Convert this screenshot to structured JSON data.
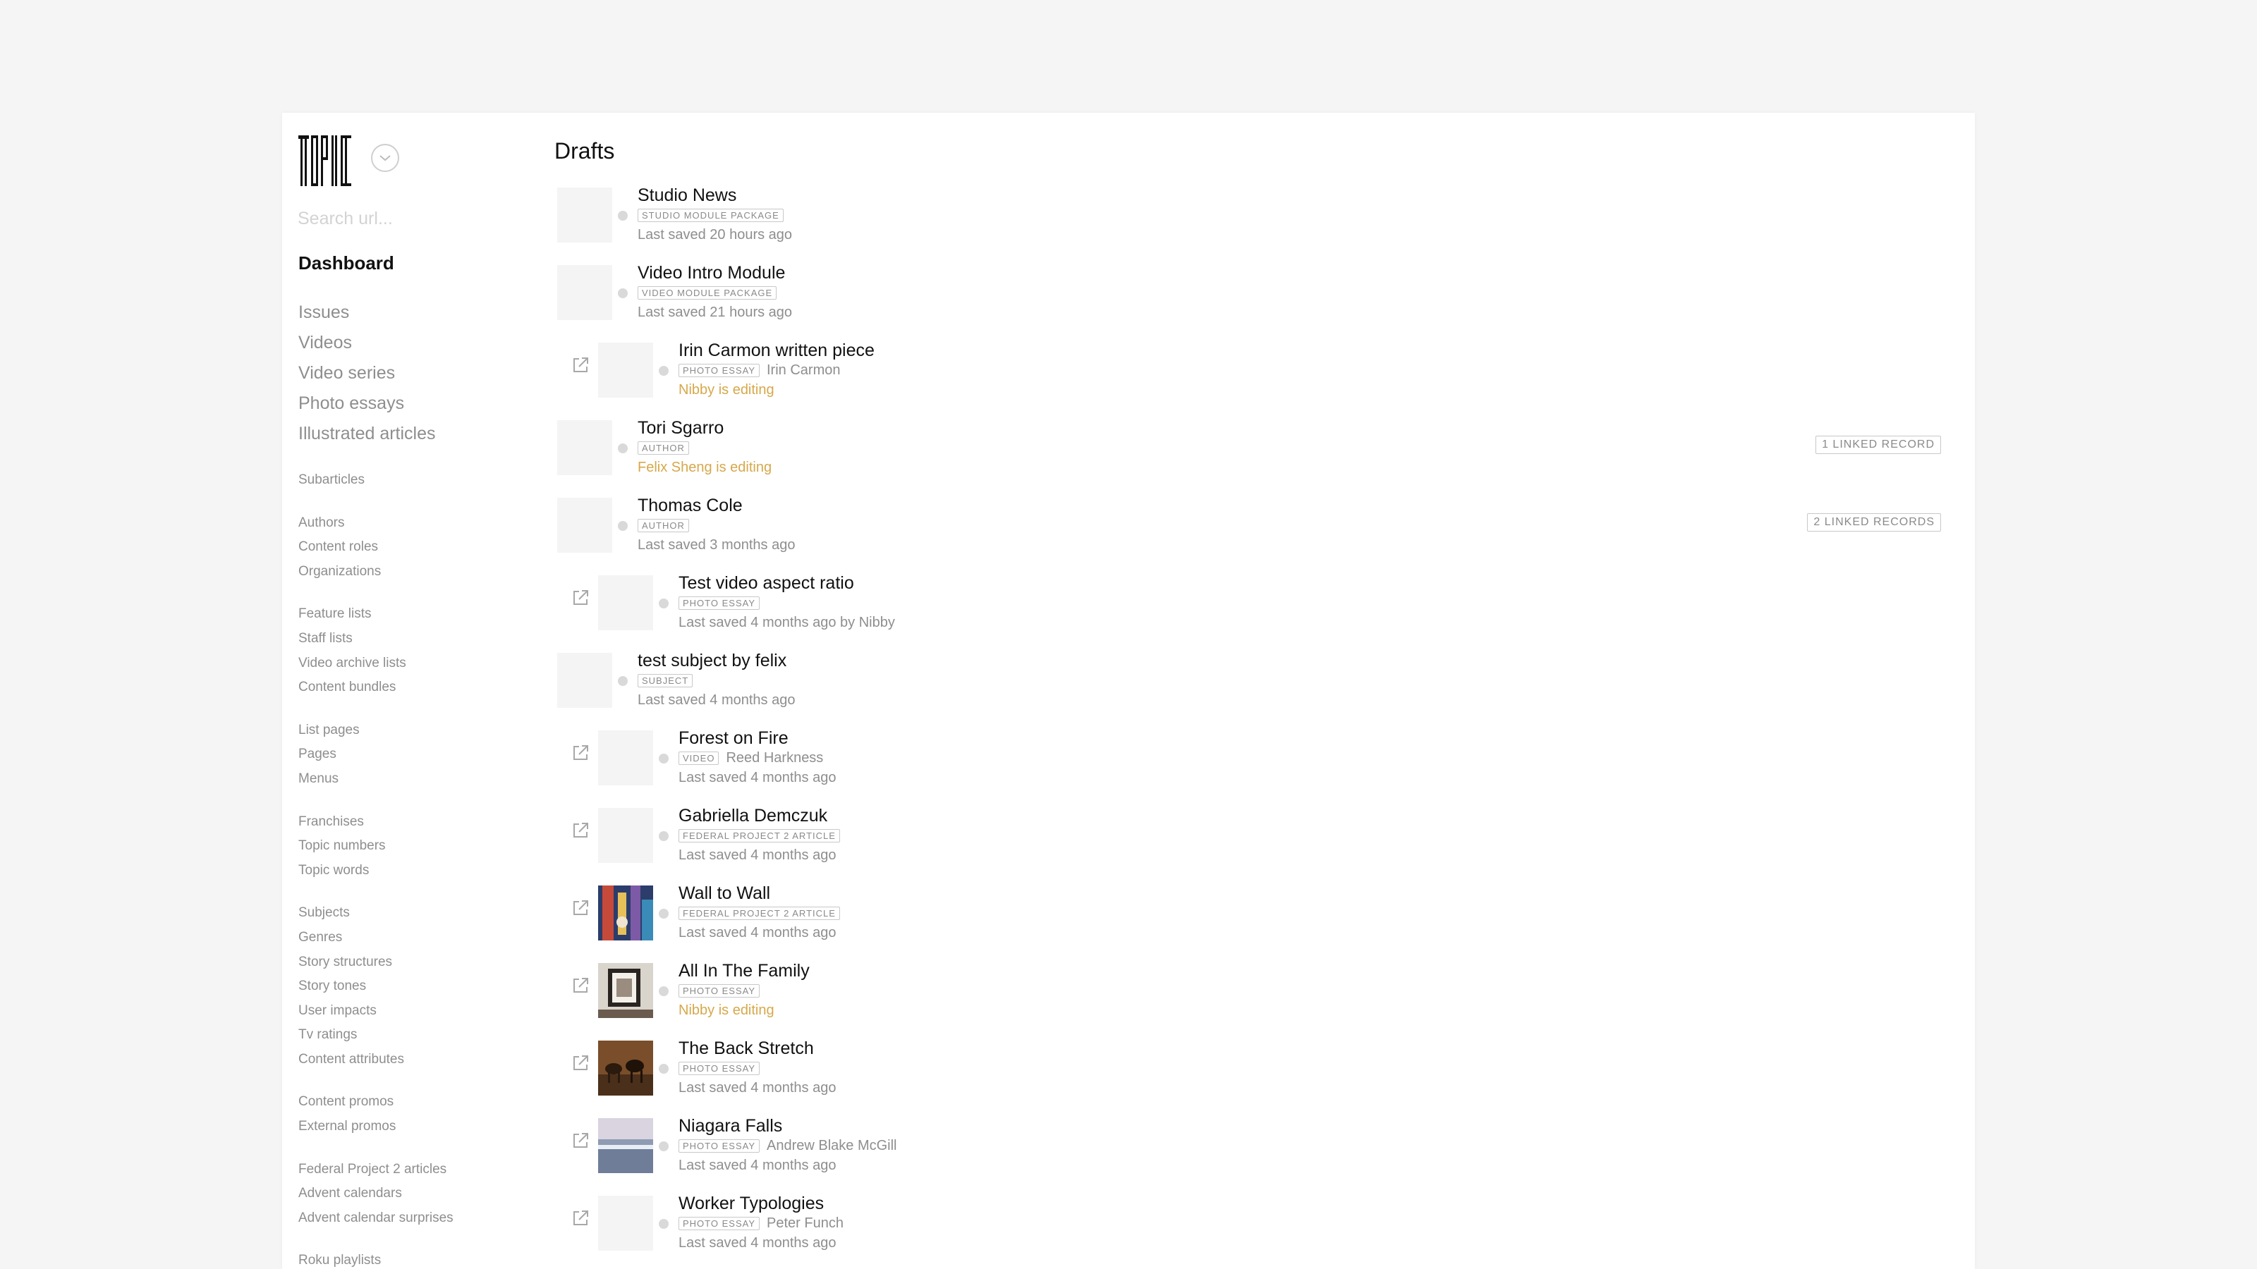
{
  "sidebar": {
    "logo_text": "TOPIC",
    "search_placeholder": "Search url...",
    "dashboard_label": "Dashboard",
    "main_items": [
      "Issues",
      "Videos",
      "Video series",
      "Photo essays",
      "Illustrated articles"
    ],
    "groups": [
      [
        "Subarticles"
      ],
      [
        "Authors",
        "Content roles",
        "Organizations"
      ],
      [
        "Feature lists",
        "Staff lists",
        "Video archive lists",
        "Content bundles"
      ],
      [
        "List pages",
        "Pages",
        "Menus"
      ],
      [
        "Franchises",
        "Topic numbers",
        "Topic words"
      ],
      [
        "Subjects",
        "Genres",
        "Story structures",
        "Story tones",
        "User impacts",
        "Tv ratings",
        "Content attributes"
      ],
      [
        "Content promos",
        "External promos"
      ],
      [
        "Federal Project 2 articles",
        "Advent calendars",
        "Advent calendar surprises"
      ],
      [
        "Roku playlists"
      ]
    ]
  },
  "main": {
    "title": "Drafts",
    "drafts": [
      {
        "title": "Studio News",
        "tag": "STUDIO MODULE PACKAGE",
        "author": "",
        "status": "Last saved 20 hours ago",
        "editing": false,
        "external_link": false,
        "thumbnail": "",
        "linked": ""
      },
      {
        "title": "Video Intro Module",
        "tag": "VIDEO MODULE PACKAGE",
        "author": "",
        "status": "Last saved 21 hours ago",
        "editing": false,
        "external_link": false,
        "thumbnail": "",
        "linked": ""
      },
      {
        "title": "Irin Carmon written piece",
        "tag": "PHOTO ESSAY",
        "author": "Irin Carmon",
        "status": "Nibby is editing",
        "editing": true,
        "external_link": true,
        "thumbnail": "",
        "linked": ""
      },
      {
        "title": "Tori Sgarro",
        "tag": "AUTHOR",
        "author": "",
        "status": "Felix Sheng is editing",
        "editing": true,
        "external_link": false,
        "thumbnail": "",
        "linked": "1 LINKED RECORD"
      },
      {
        "title": "Thomas Cole",
        "tag": "AUTHOR",
        "author": "",
        "status": "Last saved 3 months ago",
        "editing": false,
        "external_link": false,
        "thumbnail": "",
        "linked": "2 LINKED RECORDS"
      },
      {
        "title": "Test video aspect ratio",
        "tag": "PHOTO ESSAY",
        "author": "",
        "status": "Last saved 4 months ago by Nibby",
        "editing": false,
        "external_link": true,
        "thumbnail": "",
        "linked": ""
      },
      {
        "title": "test subject by felix",
        "tag": "SUBJECT",
        "author": "",
        "status": "Last saved 4 months ago",
        "editing": false,
        "external_link": false,
        "thumbnail": "",
        "linked": ""
      },
      {
        "title": "Forest on Fire",
        "tag": "VIDEO",
        "author": "Reed Harkness",
        "status": "Last saved 4 months ago",
        "editing": false,
        "external_link": true,
        "thumbnail": "",
        "linked": ""
      },
      {
        "title": "Gabriella Demczuk",
        "tag": "FEDERAL PROJECT 2 ARTICLE",
        "author": "",
        "status": "Last saved 4 months ago",
        "editing": false,
        "external_link": true,
        "thumbnail": "",
        "linked": ""
      },
      {
        "title": "Wall to Wall",
        "tag": "FEDERAL PROJECT 2 ARTICLE",
        "author": "",
        "status": "Last saved 4 months ago",
        "editing": false,
        "external_link": true,
        "thumbnail": "mural",
        "linked": ""
      },
      {
        "title": "All In The Family",
        "tag": "PHOTO ESSAY",
        "author": "",
        "status": "Nibby is editing",
        "editing": true,
        "external_link": true,
        "thumbnail": "frame",
        "linked": ""
      },
      {
        "title": "The Back Stretch",
        "tag": "PHOTO ESSAY",
        "author": "",
        "status": "Last saved 4 months ago",
        "editing": false,
        "external_link": true,
        "thumbnail": "horses",
        "linked": ""
      },
      {
        "title": "Niagara Falls",
        "tag": "PHOTO ESSAY",
        "author": "Andrew Blake McGill",
        "status": "Last saved 4 months ago",
        "editing": false,
        "external_link": true,
        "thumbnail": "falls",
        "linked": ""
      },
      {
        "title": "Worker Typologies",
        "tag": "PHOTO ESSAY",
        "author": "Peter Funch",
        "status": "Last saved 4 months ago",
        "editing": false,
        "external_link": true,
        "thumbnail": "",
        "linked": ""
      }
    ]
  },
  "colors": {
    "editing": "#d6a84b",
    "muted": "#8e8e8e",
    "background": "#f5f5f5"
  },
  "icons": {
    "external_link": "external-link-icon",
    "dropdown": "chevron-down-icon"
  }
}
